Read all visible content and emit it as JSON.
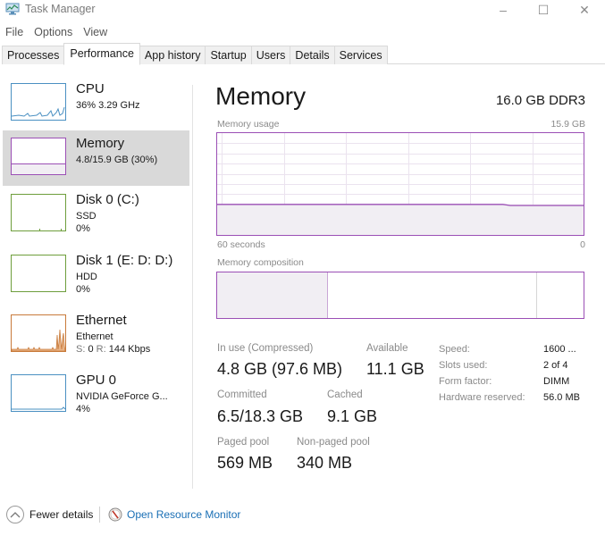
{
  "window": {
    "title": "Task Manager",
    "icon": "task-manager-icon",
    "controls": {
      "minimize": "–",
      "maximize": "☐",
      "close": "✕"
    }
  },
  "menu": [
    "File",
    "Options",
    "View"
  ],
  "tabs": [
    {
      "label": "Processes",
      "active": false
    },
    {
      "label": "Performance",
      "active": true
    },
    {
      "label": "App history",
      "active": false
    },
    {
      "label": "Startup",
      "active": false
    },
    {
      "label": "Users",
      "active": false
    },
    {
      "label": "Details",
      "active": false
    },
    {
      "label": "Services",
      "active": false
    }
  ],
  "sidebar": {
    "items": [
      {
        "title": "CPU",
        "line1": "36%  3.29 GHz",
        "line2": "",
        "color": "#4a90c2",
        "selected": false
      },
      {
        "title": "Memory",
        "line1": "4.8/15.9 GB (30%)",
        "line2": "",
        "color": "#9b4fb5",
        "selected": true
      },
      {
        "title": "Disk 0 (C:)",
        "line1": "SSD",
        "line2": "0%",
        "color": "#6e9e3c",
        "selected": false
      },
      {
        "title": "Disk 1 (E: D: D:)",
        "line1": "HDD",
        "line2": "0%",
        "color": "#6e9e3c",
        "selected": false
      },
      {
        "title": "Ethernet",
        "line1": "Ethernet",
        "line2_prefix_s": "S:",
        "line2_s": "0",
        "line2_prefix_r": "R:",
        "line2_r": "144 Kbps",
        "color": "#c87a3a",
        "selected": false
      },
      {
        "title": "GPU 0",
        "line1": "NVIDIA GeForce G...",
        "line2": "4%",
        "color": "#4a90c2",
        "selected": false
      }
    ]
  },
  "main": {
    "title": "Memory",
    "spec": "16.0 GB DDR3",
    "usage_label": "Memory usage",
    "usage_max": "15.9 GB",
    "time_left": "60 seconds",
    "time_right": "0",
    "composition_label": "Memory composition",
    "usage_percent": 30,
    "composition": [
      {
        "name": "in-use",
        "fraction": 0.3,
        "color": "#f1eef3"
      },
      {
        "name": "standby",
        "fraction": 0.57,
        "color": "#ffffff"
      },
      {
        "name": "free",
        "fraction": 0.13,
        "color": "#ffffff"
      }
    ],
    "accent": "#9b4fb5",
    "stats": {
      "in_use_label": "In use (Compressed)",
      "in_use_value": "4.8 GB (97.6 MB)",
      "available_label": "Available",
      "available_value": "11.1 GB",
      "committed_label": "Committed",
      "committed_value": "6.5/18.3 GB",
      "cached_label": "Cached",
      "cached_value": "9.1 GB",
      "paged_label": "Paged pool",
      "paged_value": "569 MB",
      "nonpaged_label": "Non-paged pool",
      "nonpaged_value": "340 MB"
    },
    "specs": [
      {
        "label": "Speed:",
        "value": "1600 ..."
      },
      {
        "label": "Slots used:",
        "value": "2 of 4"
      },
      {
        "label": "Form factor:",
        "value": "DIMM"
      },
      {
        "label": "Hardware reserved:",
        "value": "56.0 MB"
      }
    ]
  },
  "footer": {
    "fewer_details": "Fewer details",
    "resource_monitor": "Open Resource Monitor"
  }
}
